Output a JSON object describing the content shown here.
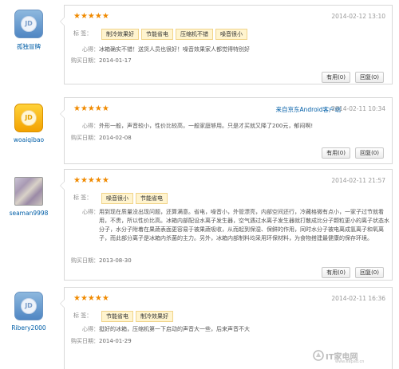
{
  "labels": {
    "tags": "标    签：",
    "experience": "心得：",
    "buy_date": "购买日期："
  },
  "reviews": [
    {
      "username": "孤独冒牌",
      "avatar": "jd-blue",
      "stars": "★★★★★",
      "date": "2014-02-12 13:10",
      "source": "",
      "tags": [
        "制冷效果好",
        "节能省电",
        "压缩机不错",
        "噪音很小"
      ],
      "content": "冰箱确实不错！送货人员也很好！噪音效果家人都觉得特别好",
      "buy_date": "2014-01-17",
      "useful": "有用(0)",
      "reply": "回复(0)"
    },
    {
      "username": "woaiqibao",
      "avatar": "jd-gold",
      "stars": "★★★★★",
      "date": "2014-02-11 10:34",
      "source": "来自京东Android客户端",
      "tags": [],
      "content": "外形一般，声音较小，性价比较高，一般家庭够用。只是才买就又降了200元，郁闷啊!",
      "buy_date": "2014-02-08",
      "useful": "有用(0)",
      "reply": "回复(0)"
    },
    {
      "username": "seaman9998",
      "avatar": "photo",
      "stars": "★★★★★",
      "date": "2014-02-11 21:57",
      "source": "",
      "tags": [
        "噪音很小",
        "节能省电"
      ],
      "content": "用到现在质量没出现问题，还算满意。省电，噪音小，外管漂亮，内部空间还行，冷藏格微有点小，一家子过节就看用，不贵，所以性价比高。冰箱内部配设水离子发生器，空气遇过水离子发生器就打散成比分子颗粒更小的离子状态水分子，水分子附着在果蔬表面更容易于被果蔬吸收，从而起到保湿、保鲜的作用，同时水分子被电离成氢离子和氧离子，而此部分离子是冰箱内杀菌的主力。另外，冰箱内部制料均采用环保材料，为食物搭建最健康的保存环境。",
      "buy_date": "2013-08-30",
      "useful": "有用(0)",
      "reply": "回复(0)"
    },
    {
      "username": "Ribery2000",
      "avatar": "jd-blue",
      "stars": "★★★★★",
      "date": "2014-02-11 16:36",
      "source": "",
      "tags": [
        "节能省电",
        "制冷效果好"
      ],
      "content": "挺好的冰箱，压缩机第一下启动的声音大一些，后来声音不大",
      "buy_date": "2014-01-29",
      "useful": "",
      "reply": ""
    }
  ],
  "avatar_text": "JD",
  "watermark": {
    "text": "IT家电网",
    "url": "www.eapad.cn"
  },
  "colors": {
    "star": "#f08a00",
    "link": "#005ea7",
    "tag_bg": "#fff4cf",
    "tag_border": "#f1d48a"
  }
}
